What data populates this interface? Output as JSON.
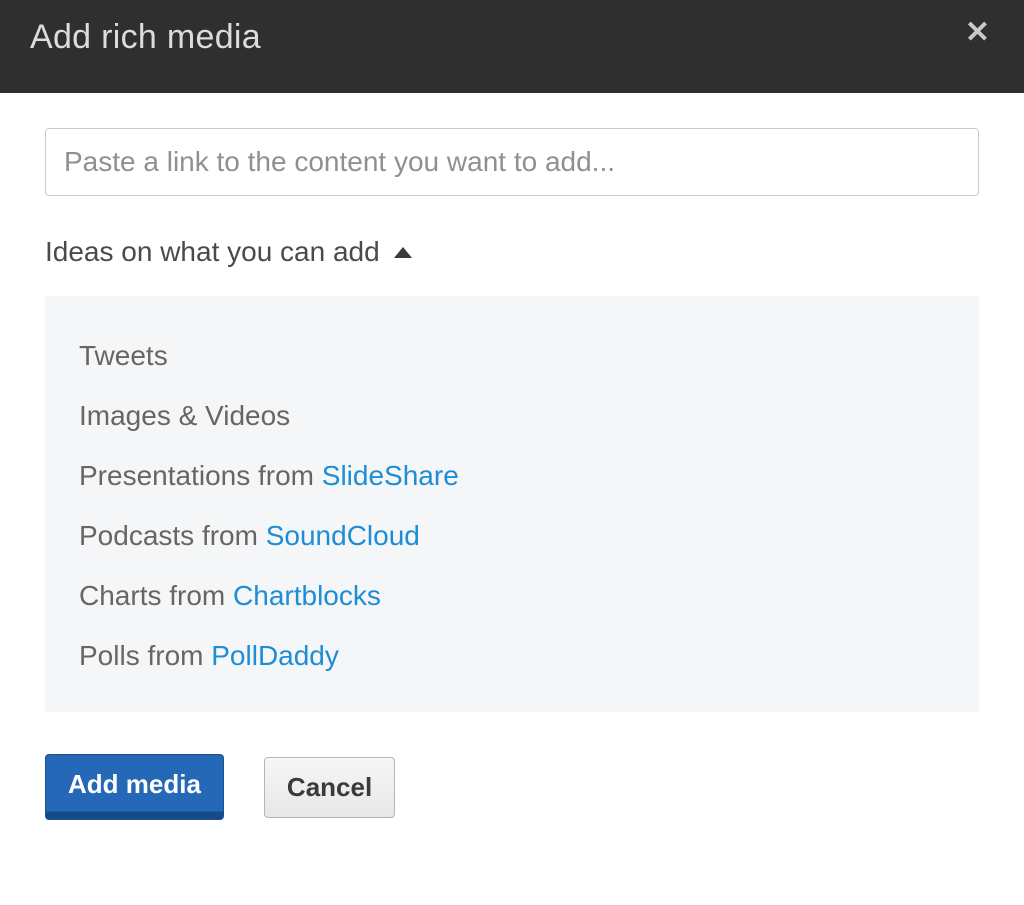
{
  "header": {
    "title": "Add rich media"
  },
  "input": {
    "placeholder": "Paste a link to the content you want to add..."
  },
  "ideas": {
    "toggle_label": "Ideas on what you can add",
    "items": [
      {
        "prefix": "Tweets",
        "link": ""
      },
      {
        "prefix": "Images & Videos",
        "link": ""
      },
      {
        "prefix": "Presentations from ",
        "link": "SlideShare"
      },
      {
        "prefix": "Podcasts from ",
        "link": "SoundCloud"
      },
      {
        "prefix": "Charts from ",
        "link": "Chartblocks"
      },
      {
        "prefix": "Polls from ",
        "link": "PollDaddy"
      }
    ]
  },
  "buttons": {
    "add_media": "Add media",
    "cancel": "Cancel"
  }
}
